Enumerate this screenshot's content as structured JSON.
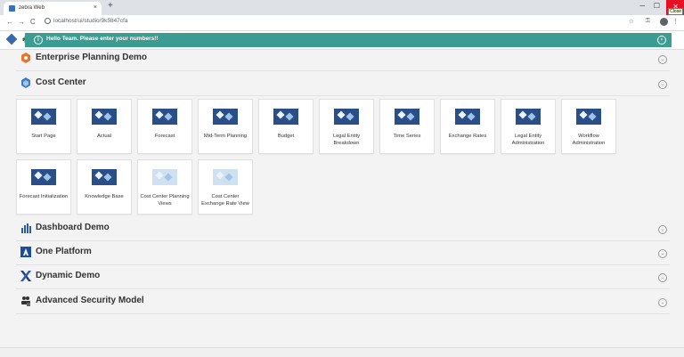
{
  "browser": {
    "tab_title": "zebra Web",
    "url": "localhost/ui/studio/9k5847cfa",
    "tooltip": "Close",
    "tab_close_glyph": "×",
    "new_tab_glyph": "+",
    "min_glyph": "─",
    "max_glyph": "☐",
    "close_glyph": "✕",
    "back_glyph": "←",
    "forward_glyph": "→",
    "reload_glyph": "C",
    "star_glyph": "☆",
    "key_glyph": "⚿",
    "menu_glyph": "⋮"
  },
  "app": {
    "print_glyph": "🖶",
    "notification": "Hello Team. Please enter your numbers!!",
    "info_glyph": "i",
    "notif_close_glyph": "×",
    "chevron_glyph": "⌄"
  },
  "sections": [
    {
      "title": "Enterprise Planning Demo",
      "icon": "hexagon-icon",
      "color": "#e8742a"
    },
    {
      "title": "Cost Center",
      "icon": "cube-icon",
      "color": "#3d7ac7"
    },
    {
      "title": "Dashboard Demo",
      "icon": "bar-chart-icon",
      "color": "#2d5aa6"
    },
    {
      "title": "One Platform",
      "icon": "platform-icon",
      "color": "#1a4e9c"
    },
    {
      "title": "Dynamic Demo",
      "icon": "x-logo-icon",
      "color": "#1b3f8b"
    },
    {
      "title": "Advanced Security Model",
      "icon": "users-lock-icon",
      "color": "#333333"
    }
  ],
  "tiles": [
    {
      "label": "Start Page"
    },
    {
      "label": "Actual"
    },
    {
      "label": "Forecast"
    },
    {
      "label": "Mid-Term Planning"
    },
    {
      "label": "Budget"
    },
    {
      "label": "Legal Entity Breakdown"
    },
    {
      "label": "Time Series"
    },
    {
      "label": "Exchange Rates"
    },
    {
      "label": "Legal Entity Administration"
    },
    {
      "label": "Workflow Administration"
    },
    {
      "label": "Forecast Initialization"
    },
    {
      "label": "Knowledge Base"
    },
    {
      "label": "Cost Center Planning Views"
    },
    {
      "label": "Cost Center Exchange Rate View"
    }
  ],
  "colors": {
    "notification_bg": "#3b9d91",
    "tile_image": "#2a4f88"
  }
}
